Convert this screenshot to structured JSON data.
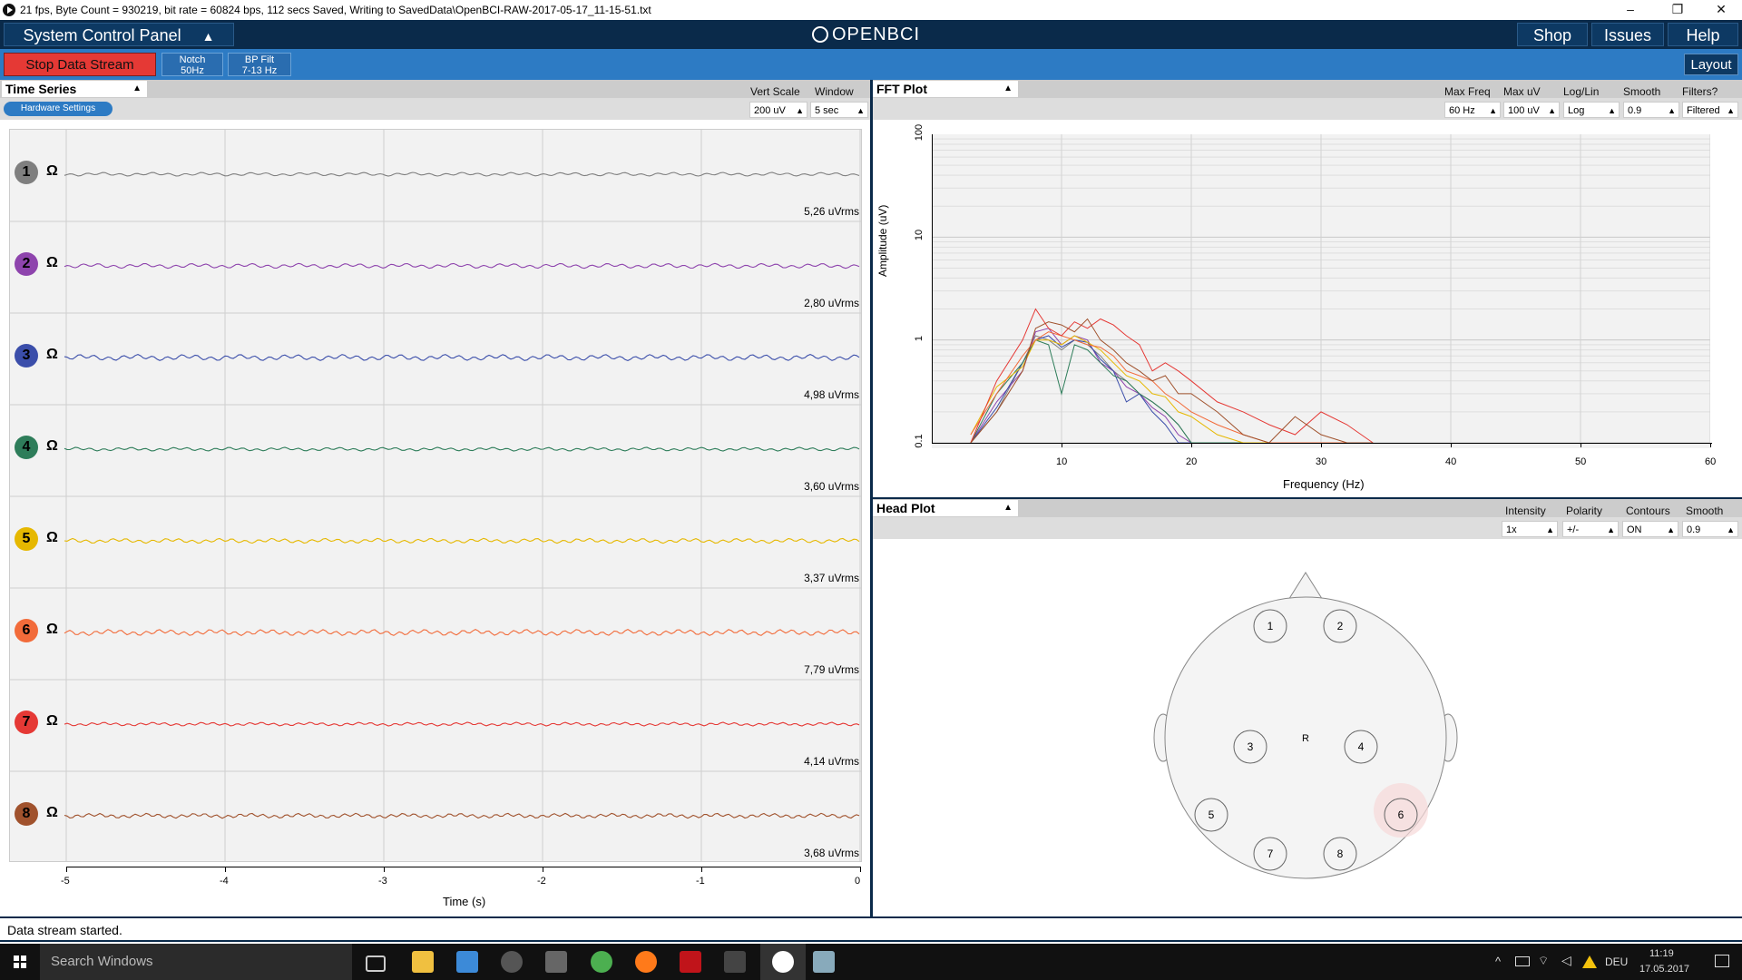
{
  "window": {
    "title": "21 fps, Byte Count = 930219, bit rate = 60824 bps, 112 secs Saved, Writing to SavedData\\OpenBCI-RAW-2017-05-17_11-15-51.txt",
    "minimize": "–",
    "maximize": "❐",
    "close": "✕"
  },
  "topnav": {
    "system_panel": "System Control Panel",
    "logo": "OPENBCI",
    "shop": "Shop",
    "issues": "Issues",
    "help": "Help"
  },
  "controls": {
    "stop": "Stop Data Stream",
    "notch_line1": "Notch",
    "notch_line2": "50Hz",
    "bp_line1": "BP Filt",
    "bp_line2": "7-13 Hz",
    "layout": "Layout"
  },
  "time_series": {
    "title": "Time Series",
    "vert_scale_label": "Vert Scale",
    "window_label": "Window",
    "vert_scale": "200 uV",
    "window": "5 sec",
    "hardware_settings": "Hardware Settings",
    "xlabel": "Time (s)",
    "ohm": "Ω",
    "channels": [
      {
        "n": "1",
        "color": "#7f7f7f",
        "rms": "5,26 uVrms"
      },
      {
        "n": "2",
        "color": "#8e44ad",
        "rms": "2,80 uVrms"
      },
      {
        "n": "3",
        "color": "#3b4eaa",
        "rms": "4,98 uVrms"
      },
      {
        "n": "4",
        "color": "#2e7d5a",
        "rms": "3,60 uVrms"
      },
      {
        "n": "5",
        "color": "#e6b800",
        "rms": "3,37 uVrms"
      },
      {
        "n": "6",
        "color": "#f26b3a",
        "rms": "7,79 uVrms"
      },
      {
        "n": "7",
        "color": "#e53935",
        "rms": "4,14 uVrms"
      },
      {
        "n": "8",
        "color": "#a0522d",
        "rms": "3,68 uVrms"
      }
    ],
    "xticks": [
      "-5",
      "-4",
      "-3",
      "-2",
      "-1",
      "0"
    ]
  },
  "fft": {
    "title": "FFT Plot",
    "labels": [
      "Max Freq",
      "Max uV",
      "Log/Lin",
      "Smooth",
      "Filters?"
    ],
    "values": [
      "60 Hz",
      "100 uV",
      "Log",
      "0.9",
      "Filtered"
    ],
    "ylabel": "Amplitude (uV)",
    "xlabel": "Frequency (Hz)",
    "xticks": [
      "10",
      "20",
      "30",
      "40",
      "50",
      "60"
    ],
    "yticks": [
      "100",
      "10",
      "1",
      "0.1"
    ]
  },
  "chart_data": {
    "type": "line",
    "xlabel": "Frequency (Hz)",
    "ylabel": "Amplitude (uV)",
    "xlim": [
      0,
      60
    ],
    "ylim": [
      0.1,
      100
    ],
    "yscale": "log",
    "grid": true,
    "x": [
      3,
      5,
      7,
      8,
      9,
      10,
      11,
      12,
      13,
      14,
      15,
      16,
      17,
      18,
      19,
      20,
      22,
      24,
      26,
      28,
      30,
      32,
      34
    ],
    "series": [
      {
        "color": "#7f7f7f",
        "values": [
          0.1,
          0.2,
          0.6,
          1.1,
          1.0,
          0.8,
          1.0,
          0.9,
          0.7,
          0.5,
          0.4,
          0.3,
          0.25,
          0.2,
          0.15,
          0.1,
          0.1,
          0.1,
          0.1,
          0.1,
          0.1,
          0.1,
          0.1
        ]
      },
      {
        "color": "#8e44ad",
        "values": [
          0.1,
          0.25,
          0.5,
          1.2,
          1.3,
          0.9,
          1.1,
          1.0,
          0.6,
          0.5,
          0.35,
          0.3,
          0.22,
          0.18,
          0.12,
          0.1,
          0.1,
          0.1,
          0.1,
          0.1,
          0.1,
          0.1,
          0.1
        ]
      },
      {
        "color": "#3b4eaa",
        "values": [
          0.1,
          0.22,
          0.6,
          1.0,
          1.1,
          0.85,
          1.0,
          0.95,
          0.65,
          0.5,
          0.25,
          0.3,
          0.2,
          0.15,
          0.1,
          0.1,
          0.1,
          0.1,
          0.1,
          0.1,
          0.1,
          0.1,
          0.1
        ]
      },
      {
        "color": "#2e7d5a",
        "values": [
          0.1,
          0.3,
          0.6,
          1.0,
          0.9,
          0.3,
          0.9,
          0.8,
          0.6,
          0.45,
          0.4,
          0.3,
          0.25,
          0.2,
          0.15,
          0.1,
          0.1,
          0.1,
          0.1,
          0.1,
          0.1,
          0.1,
          0.1
        ]
      },
      {
        "color": "#e6b800",
        "values": [
          0.12,
          0.35,
          0.55,
          1.0,
          1.0,
          0.9,
          1.1,
          0.95,
          0.8,
          0.6,
          0.45,
          0.4,
          0.3,
          0.28,
          0.2,
          0.18,
          0.12,
          0.1,
          0.1,
          0.1,
          0.1,
          0.1,
          0.1
        ]
      },
      {
        "color": "#f26b3a",
        "values": [
          0.12,
          0.3,
          0.7,
          1.0,
          1.2,
          1.1,
          1.0,
          0.9,
          0.85,
          0.7,
          0.5,
          0.45,
          0.4,
          0.3,
          0.25,
          0.2,
          0.15,
          0.12,
          0.1,
          0.1,
          0.1,
          0.1,
          0.1
        ]
      },
      {
        "color": "#e53935",
        "values": [
          0.1,
          0.4,
          1.0,
          2.0,
          1.3,
          1.1,
          1.5,
          1.3,
          1.6,
          1.4,
          1.1,
          0.9,
          0.5,
          0.6,
          0.5,
          0.4,
          0.25,
          0.2,
          0.15,
          0.12,
          0.2,
          0.15,
          0.1
        ]
      },
      {
        "color": "#a0522d",
        "values": [
          0.1,
          0.2,
          0.5,
          1.3,
          1.5,
          1.4,
          1.2,
          1.6,
          1.0,
          0.8,
          0.6,
          0.5,
          0.4,
          0.45,
          0.3,
          0.3,
          0.2,
          0.12,
          0.1,
          0.18,
          0.12,
          0.1,
          0.1
        ]
      }
    ]
  },
  "head": {
    "title": "Head Plot",
    "labels": [
      "Intensity",
      "Polarity",
      "Contours",
      "Smooth"
    ],
    "values": [
      "1x",
      "+/-",
      "ON",
      "0.9"
    ],
    "reference": "R",
    "electrodes": [
      "1",
      "2",
      "3",
      "4",
      "5",
      "6",
      "7",
      "8"
    ]
  },
  "status": "Data stream started.",
  "taskbar": {
    "search": "Search Windows",
    "lang": "DEU",
    "time": "11:19",
    "date": "17.05.2017"
  }
}
